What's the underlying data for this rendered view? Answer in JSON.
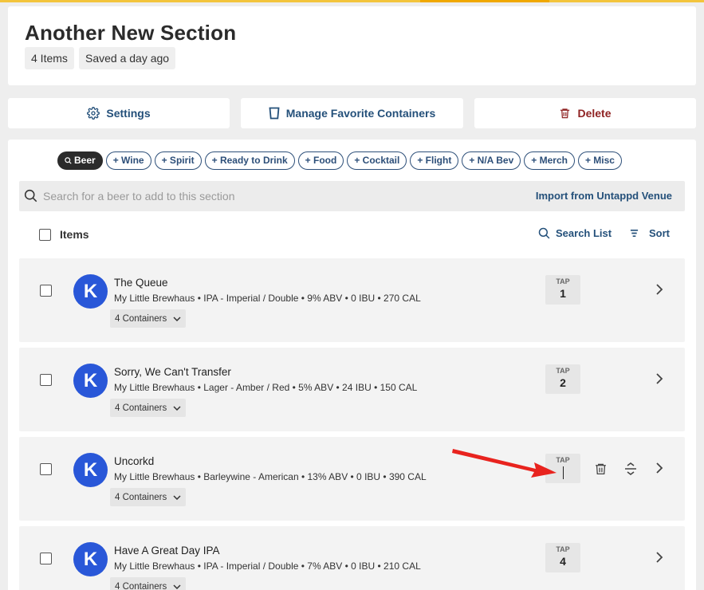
{
  "header": {
    "title": "Another New Section",
    "item_count": "4 Items",
    "saved_status": "Saved a day ago"
  },
  "actions": {
    "settings": "Settings",
    "manage_containers": "Manage Favorite Containers",
    "delete": "Delete"
  },
  "filters": [
    {
      "label": "Beer",
      "active": true
    },
    {
      "label": "+ Wine"
    },
    {
      "label": "+ Spirit"
    },
    {
      "label": "+ Ready to Drink"
    },
    {
      "label": "+ Food"
    },
    {
      "label": "+ Cocktail"
    },
    {
      "label": "+ Flight"
    },
    {
      "label": "+ N/A Bev"
    },
    {
      "label": "+ Merch"
    },
    {
      "label": "+ Misc"
    }
  ],
  "search": {
    "placeholder": "Search for a beer to add to this section",
    "value": "",
    "import_label": "Import from Untappd Venue"
  },
  "list": {
    "header_label": "Items",
    "search_list": "Search List",
    "sort": "Sort",
    "tap_label": "TAP",
    "items": [
      {
        "avatar_letter": "K",
        "name": "The Queue",
        "meta": "My Little Brewhaus • IPA - Imperial / Double • 9% ABV • 0 IBU • 270 CAL",
        "containers": "4 Containers",
        "tap": "1"
      },
      {
        "avatar_letter": "K",
        "name": "Sorry, We Can't Transfer",
        "meta": "My Little Brewhaus • Lager - Amber / Red • 5% ABV • 24 IBU • 150 CAL",
        "containers": "4 Containers",
        "tap": "2"
      },
      {
        "avatar_letter": "K",
        "name": "Uncorkd",
        "meta": "My Little Brewhaus • Barleywine - American • 13% ABV • 0 IBU • 390 CAL",
        "containers": "4 Containers",
        "tap": ""
      },
      {
        "avatar_letter": "K",
        "name": "Have A Great Day IPA",
        "meta": "My Little Brewhaus • IPA - Imperial / Double • 7% ABV • 0 IBU • 210 CAL",
        "containers": "4 Containers",
        "tap": "4"
      }
    ]
  },
  "colors": {
    "accent": "#24507a",
    "danger": "#8f2222",
    "avatar": "#2957d8",
    "annotation_arrow": "#e8231e"
  }
}
